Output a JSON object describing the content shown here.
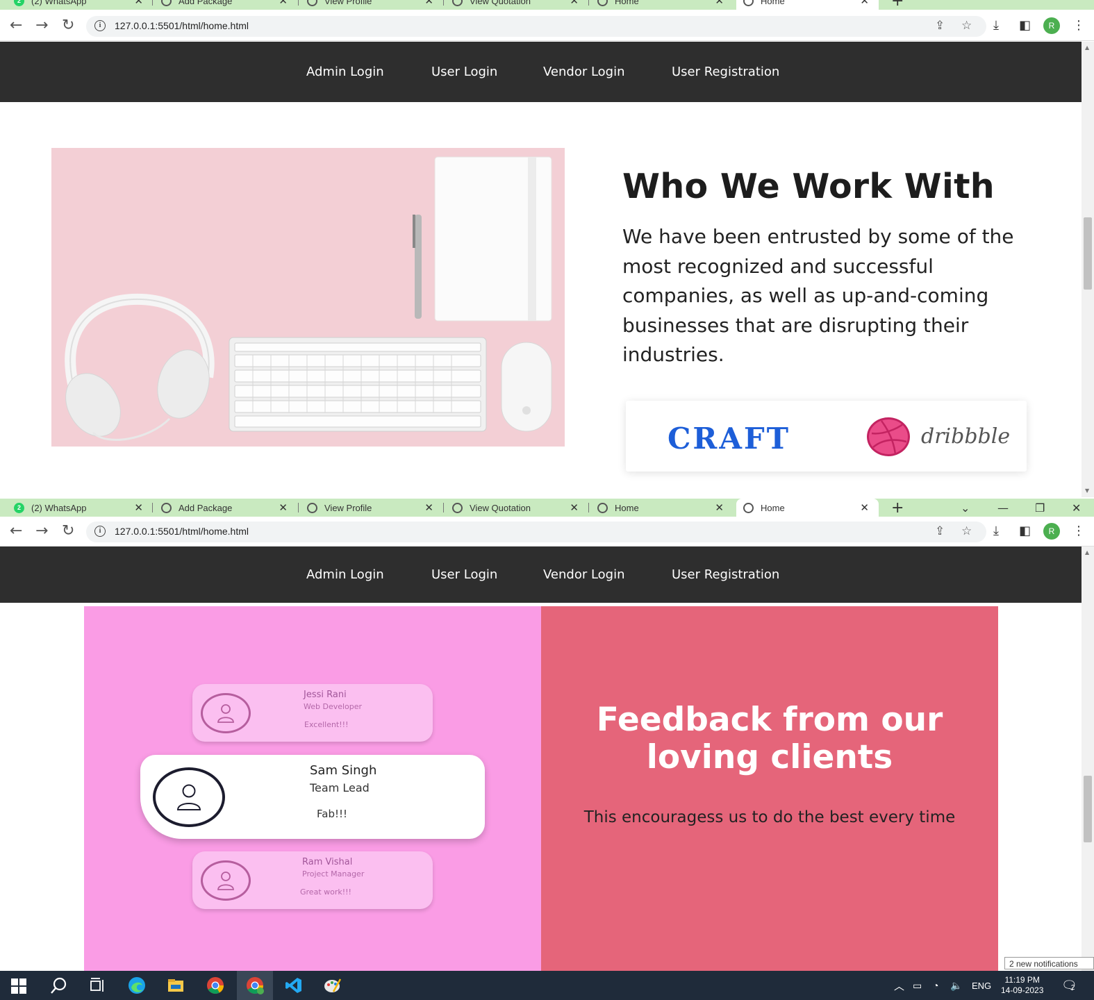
{
  "browser": {
    "tabs": [
      {
        "title": "(2) WhatsApp",
        "badge": "2"
      },
      {
        "title": "Add Package"
      },
      {
        "title": "View Profile"
      },
      {
        "title": "View Quotation"
      },
      {
        "title": "Home"
      },
      {
        "title": "Home"
      }
    ],
    "url": "127.0.0.1:5501/html/home.html",
    "profile_initial": "R"
  },
  "nav": {
    "links": [
      "Admin Login",
      "User Login",
      "Vendor Login",
      "User Registration"
    ]
  },
  "who": {
    "title": "Who We Work With",
    "text": "We have been entrusted by some of the most recognized and successful companies, as well as up-and-coming businesses that are disrupting their industries.",
    "logos": [
      "CRAFT",
      "dribbble"
    ]
  },
  "feedback": {
    "title": "Feedback from our loving clients",
    "subtitle": "This encouragess us to do the best every time",
    "cards": [
      {
        "name": "Jessi Rani",
        "role": "Web Developer",
        "comment": "Excellent!!!"
      },
      {
        "name": "Sam Singh",
        "role": "Team Lead",
        "comment": "Fab!!!"
      },
      {
        "name": "Ram Vishal",
        "role": "Project Manager",
        "comment": "Great work!!!"
      }
    ]
  },
  "taskbar": {
    "language": "ENG",
    "time": "11:19 PM",
    "date": "14-09-2023",
    "notification_count": "2",
    "notification_toast": "2 new notifications"
  },
  "colors": {
    "nav_bg": "#2e2e2e",
    "pink_panel": "#fa9ce5",
    "red_panel": "#e5657a",
    "tab_strip": "#c9eac0"
  }
}
